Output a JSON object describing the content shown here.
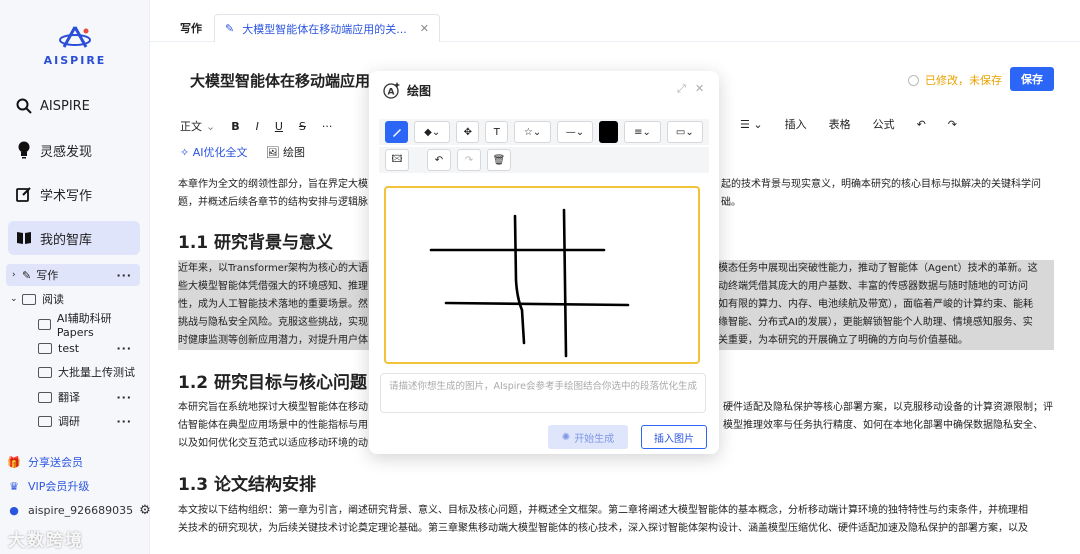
{
  "sidebar": {
    "logo_text": "AISPIRE",
    "nav": [
      {
        "label": "AISPIRE"
      },
      {
        "label": "灵感发现"
      },
      {
        "label": "学术写作"
      },
      {
        "label": "我的智库"
      }
    ],
    "tree": [
      {
        "label": "写作"
      },
      {
        "label": "阅读"
      },
      {
        "label": "AI辅助科研Papers"
      },
      {
        "label": "test"
      },
      {
        "label": "大批量上传测试"
      },
      {
        "label": "翻译"
      },
      {
        "label": "调研"
      }
    ],
    "share": "分享送会员",
    "vip": "VIP会员升级",
    "user": "aispire_926689035"
  },
  "tabs": {
    "plain": "写作",
    "active": "大模型智能体在移动端应用的关..."
  },
  "doc": {
    "title": "大模型智能体在移动端应用的关",
    "status": "已修改，未保存",
    "save": "保存"
  },
  "toolbar": {
    "style": "正文",
    "bold": "B",
    "italic": "I",
    "underline": "U",
    "strike": "S",
    "more": "···",
    "insert": "插入",
    "table": "表格",
    "formula": "公式",
    "ai_optimize": "AI优化全文",
    "draw": "绘图"
  },
  "content": {
    "intro_1": "本章作为全文的纲领性部分，旨在界定大模",
    "intro_1b": "起的技术背景与现实意义，明确本研究的核心目标与拟解决的关键科学问",
    "intro_2": "题，并概述后续各章节的结构安排与逻辑脉",
    "intro_2b": "础。",
    "h1": "1.1 研究背景与意义",
    "bg_1": "近年来，以Transformer架构为核心的大语",
    "bg_1b": "多模态任务中展现出突破性能力，推动了智能体（Agent）技术的革新。这",
    "bg_2": "些大模型智能体凭借强大的环境感知、推理",
    "bg_2b": "移动终端凭借其庞大的用户基数、丰富的传感器数据与随时随地的可访问",
    "bg_3": "性，成为人工智能技术落地的重要场景。然",
    "bg_3b": "（如有限的算力、内存、电池续航及带宽），面临着严峻的计算约束、能耗",
    "bg_4": "挑战与隐私安全风险。克服这些挑战，实现",
    "bg_4b": "边缘智能、分布式AI的发展），更能解锁智能个人助理、情境感知服务、实",
    "bg_5": "时健康监测等创新应用潜力，对提升用户体",
    "bg_5b": "至关重要，为本研究的开展确立了明确的方向与价值基础。",
    "h2": "1.2 研究目标与核心问题",
    "goal_1": "本研究旨在系统地探讨大模型智能体在移动",
    "goal_1b": "硬件适配及隐私保护等核心部署方案，以克服移动设备的计算资源限制；评",
    "goal_2": "估智能体在典型应用场景中的性能指标与用",
    "goal_2b": "模型推理效率与任务执行精度、如何在本地化部署中确保数据隐私安全、",
    "goal_3": "以及如何优化交互范式以适应移动环境的动",
    "h3": "1.3 论文结构安排",
    "struct_1": "本文按以下结构组织：第一章为引言，阐述研究背景、意义、目标及核心问题，并概述全文框架。第二章将阐述大模型智能体的基本概念，分析移动端计算环境的独特特性与约束条件，并梳理相",
    "struct_2": "关技术的研究现状，为后续关键技术讨论奠定理论基础。第三章聚焦移动端大模型智能体的核心技术，深入探讨智能体架构设计、涵盖模型压缩优化、硬件适配加速及隐私保护的部署方案，以及"
  },
  "modal": {
    "title": "绘图",
    "placeholder": "请描述你想生成的图片，AIspire会参考手绘图结合你选中的段落优化生成",
    "generate": "开始生成",
    "insert": "插入图片"
  },
  "watermark": "大数跨境",
  "colors": {
    "accent": "#2b66f6",
    "warning": "#e8a200",
    "canvas_border": "#f2c23a"
  }
}
